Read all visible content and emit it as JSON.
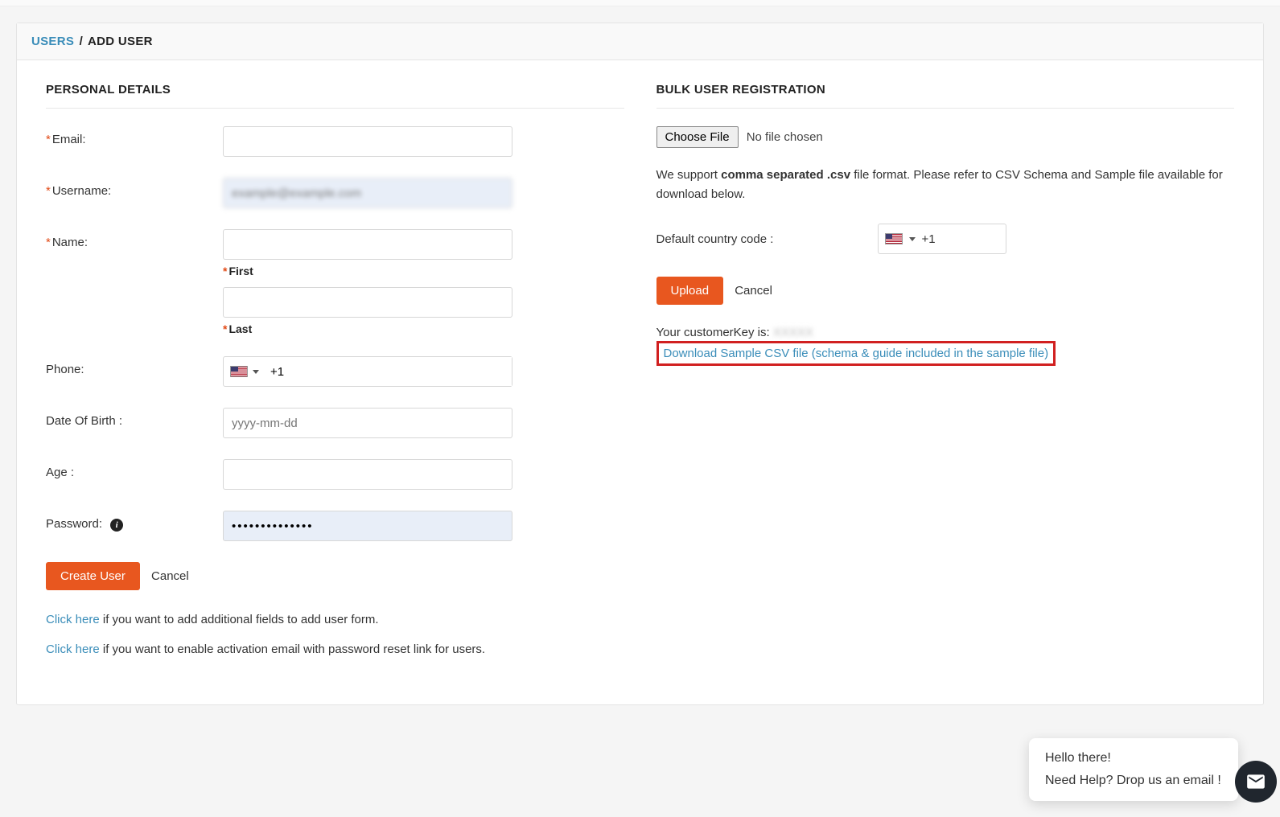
{
  "breadcrumb": {
    "parent": "USERS",
    "sep": "/",
    "current": "ADD USER"
  },
  "left": {
    "title": "PERSONAL DETAILS",
    "labels": {
      "email": "Email:",
      "username": "Username:",
      "name": "Name:",
      "first": "First",
      "last": "Last",
      "phone": "Phone:",
      "dob": "Date Of Birth :",
      "age": "Age :",
      "password": "Password:"
    },
    "values": {
      "email": "",
      "username": "example@example.com",
      "first": "",
      "last": "",
      "phone_dial": "+1",
      "dob": "",
      "dob_placeholder": "yyyy-mm-dd",
      "age": "",
      "password": "••••••••••••••"
    },
    "buttons": {
      "create": "Create User",
      "cancel": "Cancel"
    },
    "hints": {
      "h1_link": "Click here",
      "h1_rest": " if you want to add additional fields to add user form.",
      "h2_link": "Click here",
      "h2_rest": " if you want to enable activation email with password reset link for users."
    }
  },
  "right": {
    "title": "BULK USER REGISTRATION",
    "choose_file": "Choose File",
    "no_file": "No file chosen",
    "support_pre": "We support ",
    "support_bold": "comma separated .csv",
    "support_post": " file format. Please refer to CSV Schema and Sample file available for download below.",
    "cc_label": "Default country code :",
    "cc_dial": "+1",
    "buttons": {
      "upload": "Upload",
      "cancel": "Cancel"
    },
    "ckey_label": "Your customerKey is: ",
    "ckey_value": "XXXXX",
    "download_link": "Download Sample CSV file (schema & guide included in the sample file)"
  },
  "chat": {
    "greet": "Hello there!",
    "help": "Need Help? Drop us an email !"
  },
  "icons": {
    "info": "i"
  }
}
